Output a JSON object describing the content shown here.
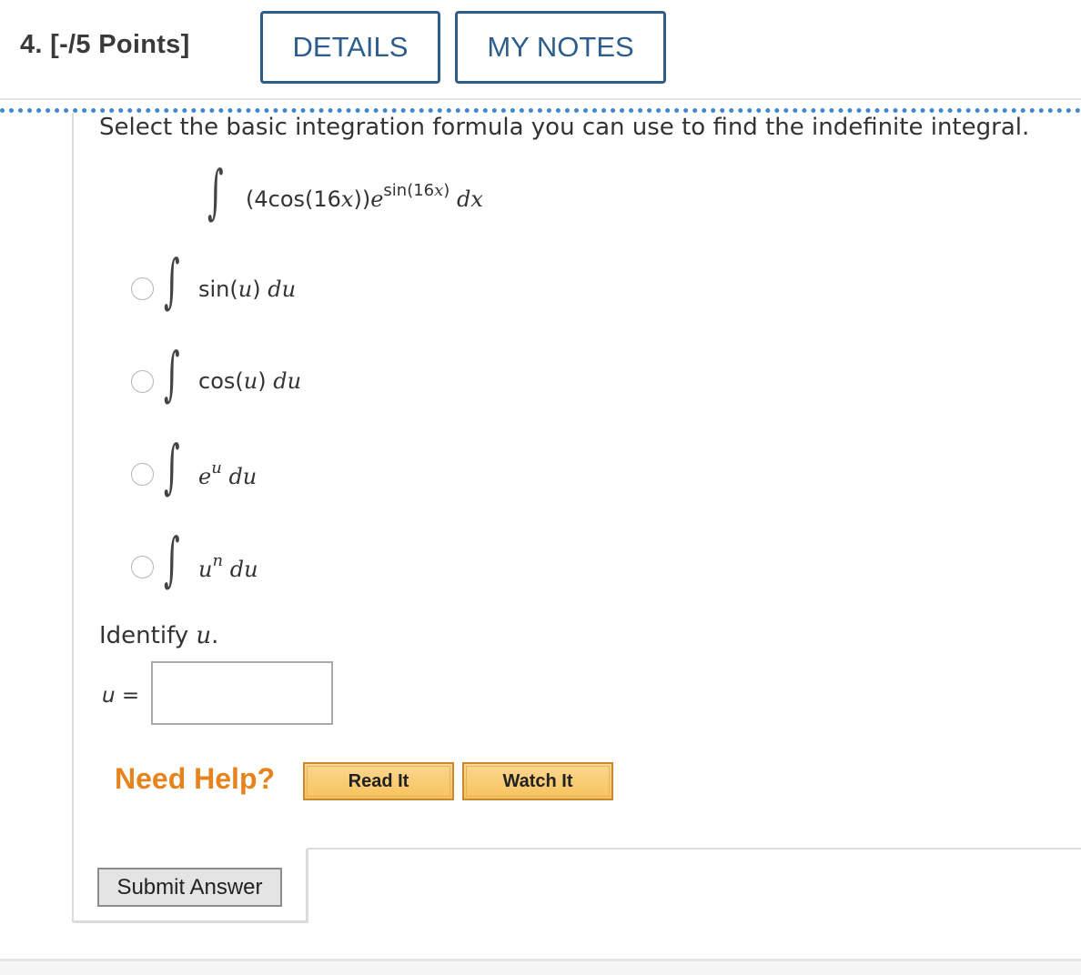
{
  "question": {
    "label": "4. [-/5 Points]",
    "details_label": "DETAILS",
    "notes_label": "MY NOTES"
  },
  "prompt": "Select the basic integration formula you can use to find the indefinite integral.",
  "integral": {
    "integrand": "(4cos(16",
    "integrand_var": "x",
    "integrand_close": "))",
    "base": "e",
    "exponent": "sin(16",
    "exponent_var": "x",
    "exponent_close": ")",
    "differential": "dx"
  },
  "options": [
    {
      "text": "sin(",
      "var": "u",
      "close": ")",
      "d": "du"
    },
    {
      "text": "cos(",
      "var": "u",
      "close": ")",
      "d": "du"
    },
    {
      "base": "e",
      "sup": "u",
      "d": "du"
    },
    {
      "base": "u",
      "sup": "n",
      "d": "du"
    }
  ],
  "identify": {
    "prefix": "Identify ",
    "var": "u",
    "suffix": ".",
    "input_label": "u =",
    "input_value": ""
  },
  "help": {
    "title": "Need Help?",
    "read_label": "Read It",
    "watch_label": "Watch It"
  },
  "submit_label": "Submit Answer"
}
